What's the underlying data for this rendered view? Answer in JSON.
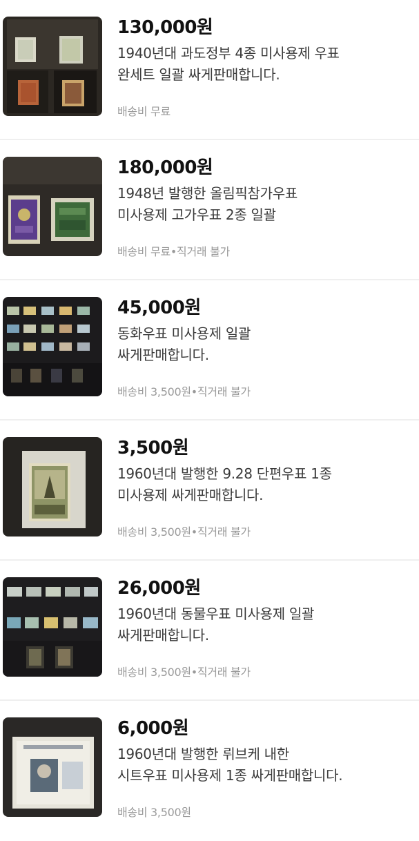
{
  "listings": [
    {
      "price": "130,000원",
      "title_line1": "1940년대 과도정부 4종 미사용제 우표",
      "title_line2": "완세트 일괄 싸게판매합니다.",
      "shipping": "배송비 무료"
    },
    {
      "price": "180,000원",
      "title_line1": "1948년 발행한 올림픽참가우표",
      "title_line2": "미사용제 고가우표 2종 일괄",
      "shipping": "배송비 무료•직거래 불가"
    },
    {
      "price": "45,000원",
      "title_line1": "동화우표 미사용제 일괄",
      "title_line2": "싸게판매합니다.",
      "shipping": "배송비 3,500원•직거래 불가"
    },
    {
      "price": "3,500원",
      "title_line1": "1960년대 발행한 9.28 단편우표 1종",
      "title_line2": "미사용제 싸게판매합니다.",
      "shipping": "배송비 3,500원•직거래 불가"
    },
    {
      "price": "26,000원",
      "title_line1": "1960년대 동물우표 미사용제 일괄",
      "title_line2": "싸게판매합니다.",
      "shipping": "배송비 3,500원•직거래 불가"
    },
    {
      "price": "6,000원",
      "title_line1": "1960년대 발행한 뤼브케 내한",
      "title_line2": "시트우표 미사용제 1종 싸게판매합니다.",
      "shipping": "배송비 3,500원"
    }
  ]
}
